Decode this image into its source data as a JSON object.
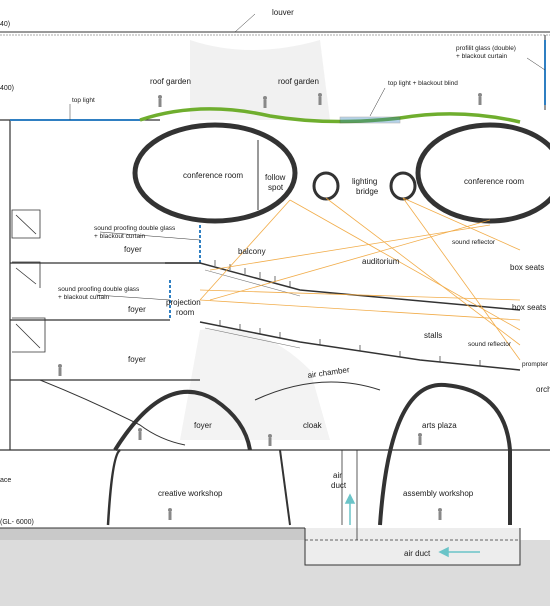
{
  "labels": {
    "louver": "louver",
    "profilit_glass": "profilit glass (double)",
    "blackout_curtain_right": "+ blackout curtain",
    "roof_garden_left": "roof garden",
    "roof_garden_right": "roof garden",
    "top_light": "top light",
    "top_light_blackout": "top light + blackout blind",
    "conference_room_left": "conference room",
    "conference_room_right": "conference room",
    "follow_spot_1": "follow",
    "follow_spot_2": "spot",
    "lighting_bridge_1": "lighting",
    "lighting_bridge_2": "bridge",
    "sound_reflector_top": "sound reflector",
    "sound_proofing_1a": "sound proofing double glass",
    "sound_proofing_1b": "+ blackout curtain",
    "balcony": "balcony",
    "auditorium": "auditorium",
    "box_seats_1": "box seats",
    "box_seats_2": "box seats",
    "foyer_1": "foyer",
    "foyer_2": "foyer",
    "foyer_3": "foyer",
    "foyer_4": "foyer",
    "sound_proofing_2a": "sound proofing double glass",
    "sound_proofing_2b": "+ blackout curtain",
    "projection_1": "projection",
    "projection_2": "room",
    "stalls": "stalls",
    "sound_reflector_mid": "sound reflector",
    "prompter": "prompter",
    "orch": "orch",
    "air_chamber": "air chamber",
    "cloak": "cloak",
    "arts_plaza": "arts plaza",
    "air_duct_v1": "air",
    "air_duct_v2": "duct",
    "creative_workshop": "creative workshop",
    "assembly_workshop": "assembly workshop",
    "air_duct_h": "air duct",
    "level_top": "40)",
    "level_second": "400)",
    "level_ground": "ace",
    "level_basement": "(GL- 6000)"
  },
  "colors": {
    "line": "#333333",
    "grey_fill": "#e6e6e6",
    "ground": "#d9d9d9",
    "green_roof": "#6fae2e",
    "blue_glass": "#2f7fc2",
    "light_ray": "#f0a437",
    "duct_arrow": "#6bc4c8"
  }
}
